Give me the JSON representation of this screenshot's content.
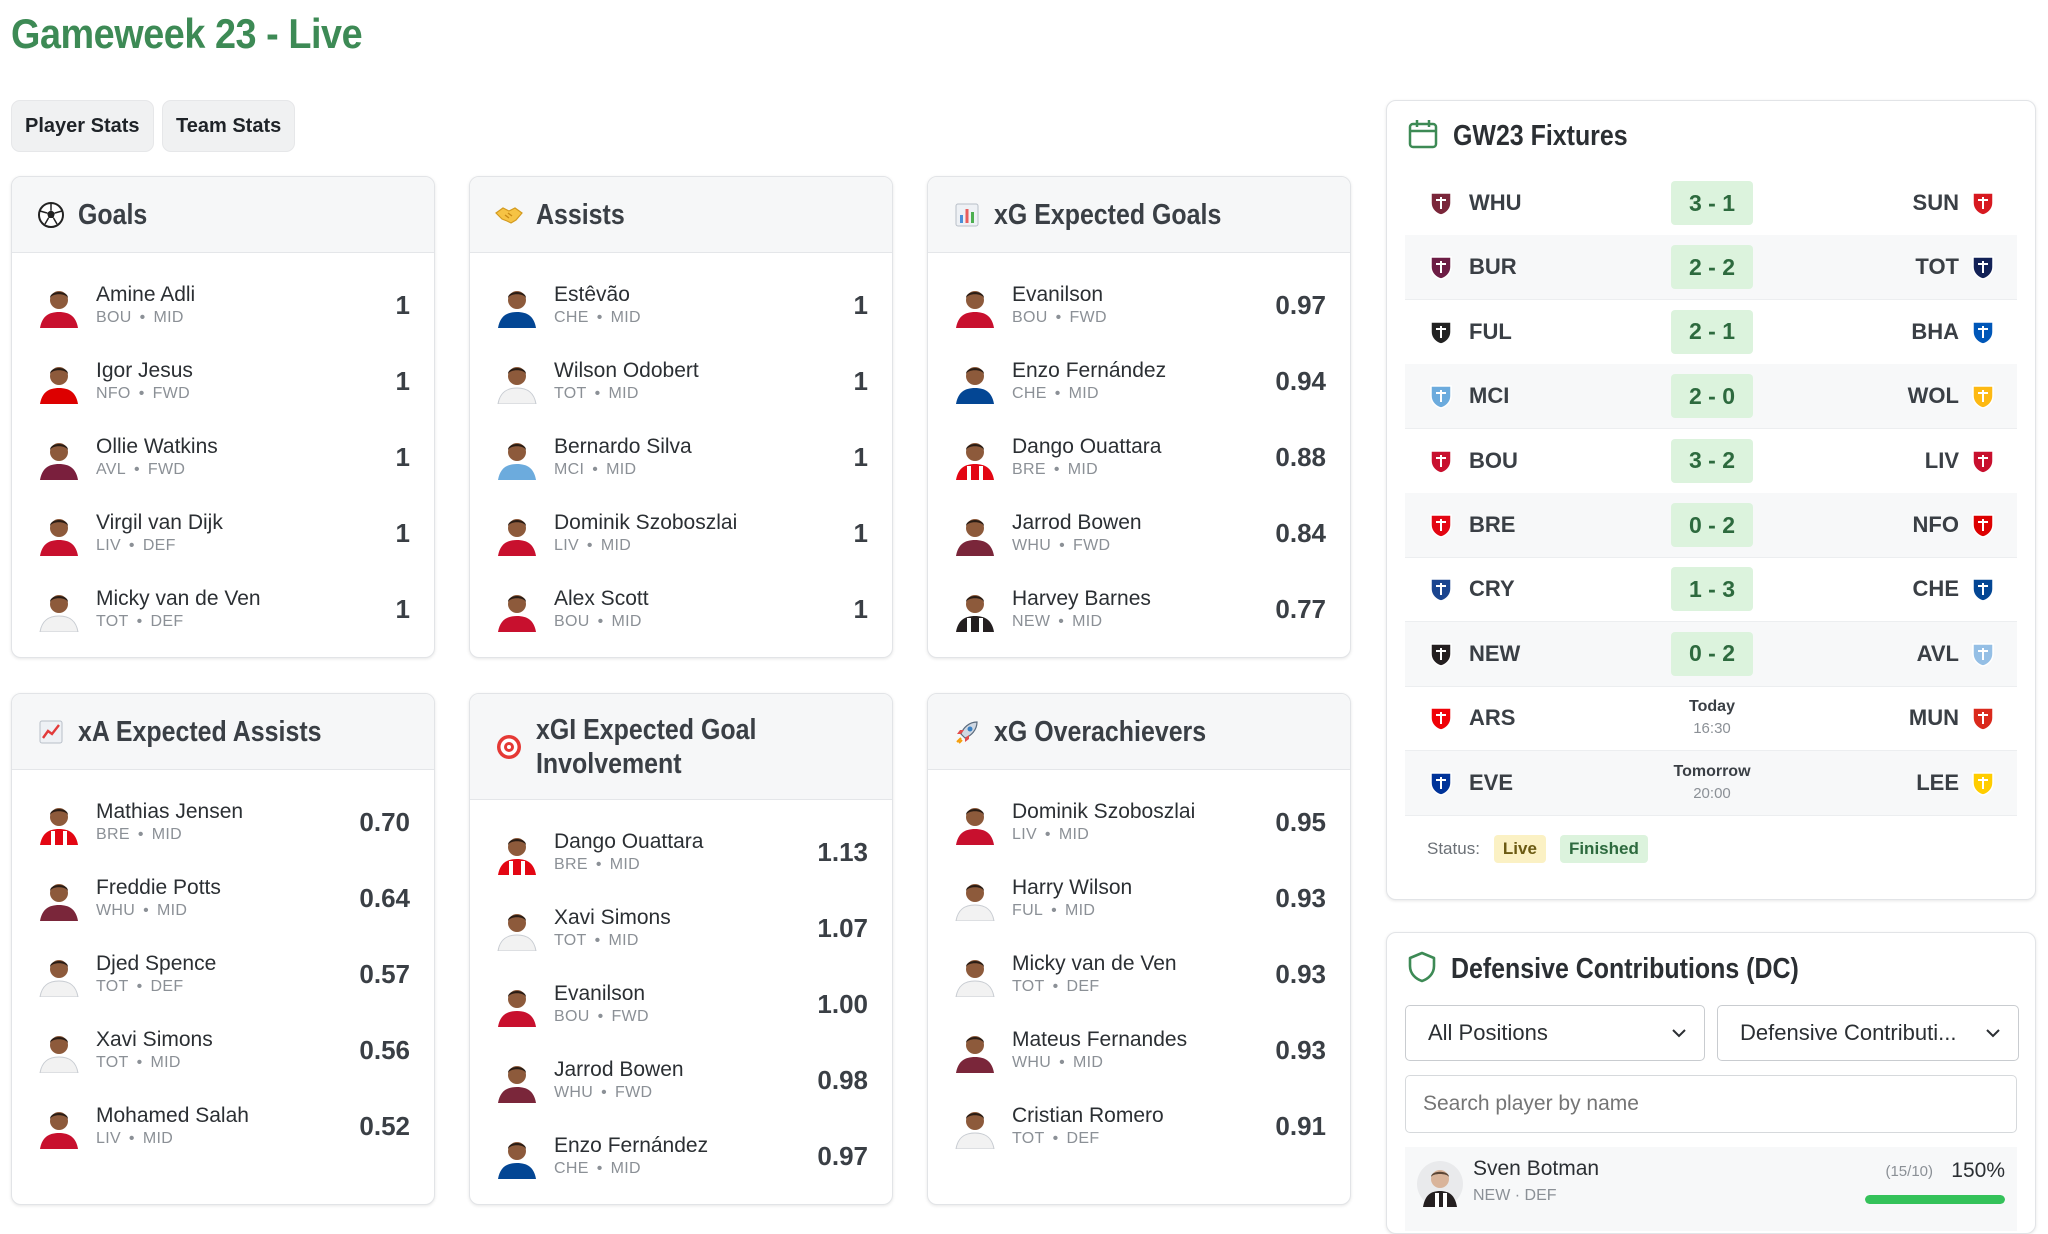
{
  "page": {
    "title": "Gameweek 23 - Live"
  },
  "tabs": [
    "Player Stats",
    "Team Stats"
  ],
  "cards": [
    {
      "title": "Goals",
      "icon": "soccer-ball-icon",
      "rows": [
        {
          "name": "Amine Adli",
          "team": "BOU",
          "pos": "MID",
          "value": "1",
          "kit": "#c8102e"
        },
        {
          "name": "Igor Jesus",
          "team": "NFO",
          "pos": "FWD",
          "value": "1",
          "kit": "#dd0000"
        },
        {
          "name": "Ollie Watkins",
          "team": "AVL",
          "pos": "FWD",
          "value": "1",
          "kit": "#7a1f3d"
        },
        {
          "name": "Virgil van Dijk",
          "team": "LIV",
          "pos": "DEF",
          "value": "1",
          "kit": "#c8102e"
        },
        {
          "name": "Micky van de Ven",
          "team": "TOT",
          "pos": "DEF",
          "value": "1",
          "kit": "#f2f2f2"
        }
      ]
    },
    {
      "title": "Assists",
      "icon": "handshake-icon",
      "rows": [
        {
          "name": "Estêvão",
          "team": "CHE",
          "pos": "MID",
          "value": "1",
          "kit": "#034694"
        },
        {
          "name": "Wilson Odobert",
          "team": "TOT",
          "pos": "MID",
          "value": "1",
          "kit": "#f2f2f2"
        },
        {
          "name": "Bernardo Silva",
          "team": "MCI",
          "pos": "MID",
          "value": "1",
          "kit": "#6cabdd"
        },
        {
          "name": "Dominik Szoboszlai",
          "team": "LIV",
          "pos": "MID",
          "value": "1",
          "kit": "#c8102e"
        },
        {
          "name": "Alex Scott",
          "team": "BOU",
          "pos": "MID",
          "value": "1",
          "kit": "#c8102e"
        }
      ]
    },
    {
      "title": "xG Expected Goals",
      "icon": "bar-chart-icon",
      "rows": [
        {
          "name": "Evanilson",
          "team": "BOU",
          "pos": "FWD",
          "value": "0.97",
          "kit": "#c8102e"
        },
        {
          "name": "Enzo Fernández",
          "team": "CHE",
          "pos": "MID",
          "value": "0.94",
          "kit": "#034694"
        },
        {
          "name": "Dango Ouattara",
          "team": "BRE",
          "pos": "MID",
          "value": "0.88",
          "kit": "#e30613"
        },
        {
          "name": "Jarrod Bowen",
          "team": "WHU",
          "pos": "FWD",
          "value": "0.84",
          "kit": "#7a263a"
        },
        {
          "name": "Harvey Barnes",
          "team": "NEW",
          "pos": "MID",
          "value": "0.77",
          "kit": "#241f20"
        }
      ]
    },
    {
      "title": "xA Expected Assists",
      "icon": "trend-chart-icon",
      "rows": [
        {
          "name": "Mathias Jensen",
          "team": "BRE",
          "pos": "MID",
          "value": "0.70",
          "kit": "#e30613"
        },
        {
          "name": "Freddie Potts",
          "team": "WHU",
          "pos": "MID",
          "value": "0.64",
          "kit": "#7a263a"
        },
        {
          "name": "Djed Spence",
          "team": "TOT",
          "pos": "DEF",
          "value": "0.57",
          "kit": "#f2f2f2"
        },
        {
          "name": "Xavi Simons",
          "team": "TOT",
          "pos": "MID",
          "value": "0.56",
          "kit": "#f2f2f2"
        },
        {
          "name": "Mohamed Salah",
          "team": "LIV",
          "pos": "MID",
          "value": "0.52",
          "kit": "#c8102e"
        }
      ]
    },
    {
      "title": "xGI Expected Goal Involvement",
      "icon": "target-icon",
      "rows": [
        {
          "name": "Dango Ouattara",
          "team": "BRE",
          "pos": "MID",
          "value": "1.13",
          "kit": "#e30613"
        },
        {
          "name": "Xavi Simons",
          "team": "TOT",
          "pos": "MID",
          "value": "1.07",
          "kit": "#f2f2f2"
        },
        {
          "name": "Evanilson",
          "team": "BOU",
          "pos": "FWD",
          "value": "1.00",
          "kit": "#c8102e"
        },
        {
          "name": "Jarrod Bowen",
          "team": "WHU",
          "pos": "FWD",
          "value": "0.98",
          "kit": "#7a263a"
        },
        {
          "name": "Enzo Fernández",
          "team": "CHE",
          "pos": "MID",
          "value": "0.97",
          "kit": "#034694"
        }
      ]
    },
    {
      "title": "xG Overachievers",
      "icon": "rocket-icon",
      "rows": [
        {
          "name": "Dominik Szoboszlai",
          "team": "LIV",
          "pos": "MID",
          "value": "0.95",
          "kit": "#c8102e"
        },
        {
          "name": "Harry Wilson",
          "team": "FUL",
          "pos": "MID",
          "value": "0.93",
          "kit": "#f2f2f2"
        },
        {
          "name": "Micky van de Ven",
          "team": "TOT",
          "pos": "DEF",
          "value": "0.93",
          "kit": "#f2f2f2"
        },
        {
          "name": "Mateus Fernandes",
          "team": "WHU",
          "pos": "MID",
          "value": "0.93",
          "kit": "#7a263a"
        },
        {
          "name": "Cristian Romero",
          "team": "TOT",
          "pos": "DEF",
          "value": "0.91",
          "kit": "#f2f2f2"
        }
      ]
    }
  ],
  "fixtures": {
    "title": "GW23 Fixtures",
    "icon": "calendar-icon",
    "matches": [
      {
        "home": "WHU",
        "away": "SUN",
        "score": "3 - 1",
        "home_color": "#7a263a",
        "away_color": "#d71920"
      },
      {
        "home": "BUR",
        "away": "TOT",
        "score": "2 - 2",
        "home_color": "#6c1d45",
        "away_color": "#132257"
      },
      {
        "home": "FUL",
        "away": "BHA",
        "score": "2 - 1",
        "home_color": "#222222",
        "away_color": "#0057b8"
      },
      {
        "home": "MCI",
        "away": "WOL",
        "score": "2 - 0",
        "home_color": "#6cabdd",
        "away_color": "#fdb913"
      },
      {
        "home": "BOU",
        "away": "LIV",
        "score": "3 - 2",
        "home_color": "#c8102e",
        "away_color": "#c8102e"
      },
      {
        "home": "BRE",
        "away": "NFO",
        "score": "0 - 2",
        "home_color": "#e30613",
        "away_color": "#dd0000"
      },
      {
        "home": "CRY",
        "away": "CHE",
        "score": "1 - 3",
        "home_color": "#1b458f",
        "away_color": "#034694"
      },
      {
        "home": "NEW",
        "away": "AVL",
        "score": "0 - 2",
        "home_color": "#241f20",
        "away_color": "#95bfe5"
      },
      {
        "home": "ARS",
        "away": "MUN",
        "when": "Today",
        "time": "16:30",
        "home_color": "#ef0107",
        "away_color": "#da291c"
      },
      {
        "home": "EVE",
        "away": "LEE",
        "when": "Tomorrow",
        "time": "20:00",
        "home_color": "#003399",
        "away_color": "#ffcd00"
      }
    ],
    "status_label": "Status:",
    "badges": [
      "Live",
      "Finished"
    ]
  },
  "dc": {
    "title": "Defensive Contributions (DC)",
    "icon": "shield-icon",
    "position_select": "All Positions",
    "sort_select": "Defensive Contributi...",
    "search_placeholder": "Search player by name",
    "player": {
      "name": "Sven Botman",
      "meta": "NEW · DEF",
      "ratio": "(15/10)",
      "pct": "150%",
      "progress": 1.0
    }
  },
  "colors": {
    "brand_green": "#3d8a55",
    "score_bg": "#dcf3dd",
    "live_bg": "#fbf1c4",
    "progress": "#34c25a"
  }
}
